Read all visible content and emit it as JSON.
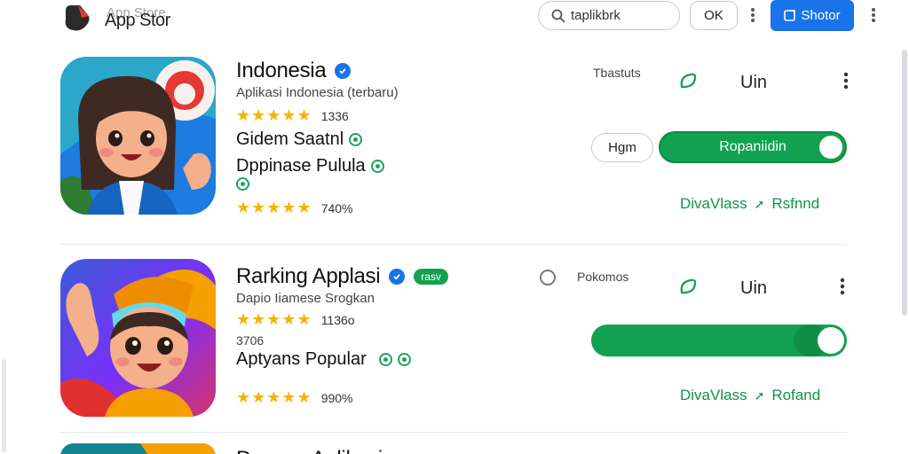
{
  "header": {
    "brand_back": "App Store",
    "brand": "App Stor",
    "search_value": "taplikbrk",
    "ok_label": "OK",
    "store_label": "Shotor"
  },
  "cards": [
    {
      "title": "Indonesia",
      "subtitle": "Aplikasi Indonesia (terbaru)",
      "rating_value": "4.5",
      "stars": "★★★★★",
      "rating_count": "1336",
      "line1": "Gidem Saatnl",
      "line2": "Dppinase Pulula",
      "stars2": "★★★★★",
      "percent": "740%",
      "meta": "Tbastuts",
      "install_label": "Uin",
      "ghost_label": "Hgm",
      "pill_label": "Ropaniidin",
      "link_label": "DivaVlass",
      "link2_label": "Rsfnnd"
    },
    {
      "title": "Rarking Applasi",
      "tag": "rasv",
      "subtitle": "Dapio Iiamese Srogkan",
      "stars": "★★★★★",
      "rating_count": "1136o",
      "small": "3706",
      "line1": "Aptyans Popular",
      "stars2": "★★★★★",
      "percent": "990%",
      "meta": "Pokomos",
      "install_label": "Uin",
      "link_label": "DivaVlass",
      "link2_label": "Rofand"
    },
    {
      "title": "Dsanes Aplikasi"
    }
  ],
  "colors": {
    "accent": "#1a73e8",
    "green": "#12a150",
    "star": "#f4b400"
  }
}
